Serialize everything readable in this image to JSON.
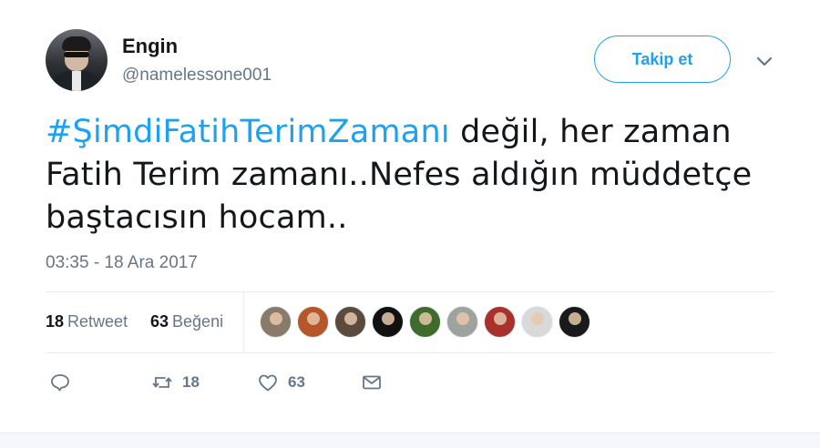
{
  "user": {
    "name": "Engin",
    "handle": "@namelessone001",
    "avatar_icon": "profile-photo"
  },
  "header": {
    "follow_label": "Takip et",
    "menu_icon": "chevron-down-icon",
    "accent": "#1da1f2"
  },
  "tweet": {
    "hashtag": "#ŞimdiFatihTerimZamanı",
    "text_line1": " değil, her zaman",
    "text_line2": "Fatih Terim zamanı..Nefes aldığın müddetçe",
    "text_line3": "baştacısın hocam..",
    "timestamp": "03:35 - 18 Ara 2017"
  },
  "stats": {
    "retweets_count": "18",
    "retweets_label": "Retweet",
    "likes_count": "63",
    "likes_label": "Beğeni"
  },
  "likers": [
    {
      "name": "liker-1",
      "color": "#8a7a6a"
    },
    {
      "name": "liker-2",
      "color": "#b5562b"
    },
    {
      "name": "liker-3",
      "color": "#5a4b3d"
    },
    {
      "name": "liker-4",
      "color": "#111111"
    },
    {
      "name": "liker-5",
      "color": "#3f6b2c"
    },
    {
      "name": "liker-6",
      "color": "#9fa3a0"
    },
    {
      "name": "liker-7",
      "color": "#a8312e"
    },
    {
      "name": "liker-8",
      "color": "#d9d9d9"
    },
    {
      "name": "liker-9",
      "color": "#1a1a1a"
    }
  ],
  "actions": {
    "reply_icon": "reply-icon",
    "retweet_icon": "retweet-icon",
    "retweet_count": "18",
    "like_icon": "heart-icon",
    "like_count": "63",
    "dm_icon": "envelope-icon"
  }
}
